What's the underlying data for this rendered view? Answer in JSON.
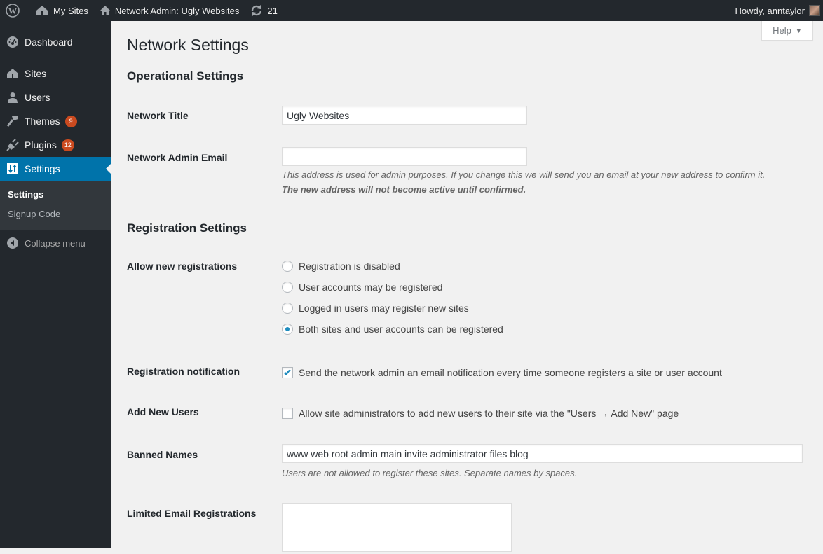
{
  "adminbar": {
    "wp_logo": "wordpress-logo",
    "my_sites": "My Sites",
    "network_admin": "Network Admin: Ugly Websites",
    "updates_count": "21",
    "howdy": "Howdy, anntaylor"
  },
  "sidebar": {
    "items": [
      {
        "label": "Dashboard",
        "icon": "dashboard-icon"
      },
      {
        "label": "Sites",
        "icon": "sites-icon"
      },
      {
        "label": "Users",
        "icon": "users-icon"
      },
      {
        "label": "Themes",
        "icon": "themes-icon",
        "badge": "9"
      },
      {
        "label": "Plugins",
        "icon": "plugins-icon",
        "badge": "12"
      },
      {
        "label": "Settings",
        "icon": "settings-icon",
        "active": true
      }
    ],
    "submenu": [
      {
        "label": "Settings",
        "current": true
      },
      {
        "label": "Signup Code"
      }
    ],
    "collapse": "Collapse menu"
  },
  "help": {
    "label": "Help"
  },
  "page": {
    "title": "Network Settings",
    "operational": {
      "heading": "Operational Settings",
      "network_title_label": "Network Title",
      "network_title_value": "Ugly Websites",
      "admin_email_label": "Network Admin Email",
      "admin_email_value": "",
      "admin_email_desc_1": "This address is used for admin purposes. If you change this we will send you an email at your new address to confirm it.",
      "admin_email_desc_2": "The new address will not become active until confirmed."
    },
    "registration": {
      "heading": "Registration Settings",
      "allow_label": "Allow new registrations",
      "options": [
        {
          "label": "Registration is disabled",
          "checked": false
        },
        {
          "label": "User accounts may be registered",
          "checked": false
        },
        {
          "label": "Logged in users may register new sites",
          "checked": false
        },
        {
          "label": "Both sites and user accounts can be registered",
          "checked": true
        }
      ],
      "notification_label": "Registration notification",
      "notification_text": "Send the network admin an email notification every time someone registers a site or user account",
      "notification_checked": true,
      "add_users_label": "Add New Users",
      "add_users_text": "Allow site administrators to add new users to their site via the \"Users → Add New\" page",
      "add_users_checked": false,
      "banned_label": "Banned Names",
      "banned_value": "www web root admin main invite administrator files blog",
      "banned_desc": "Users are not allowed to register these sites. Separate names by spaces.",
      "limited_label": "Limited Email Registrations",
      "limited_value": ""
    }
  }
}
